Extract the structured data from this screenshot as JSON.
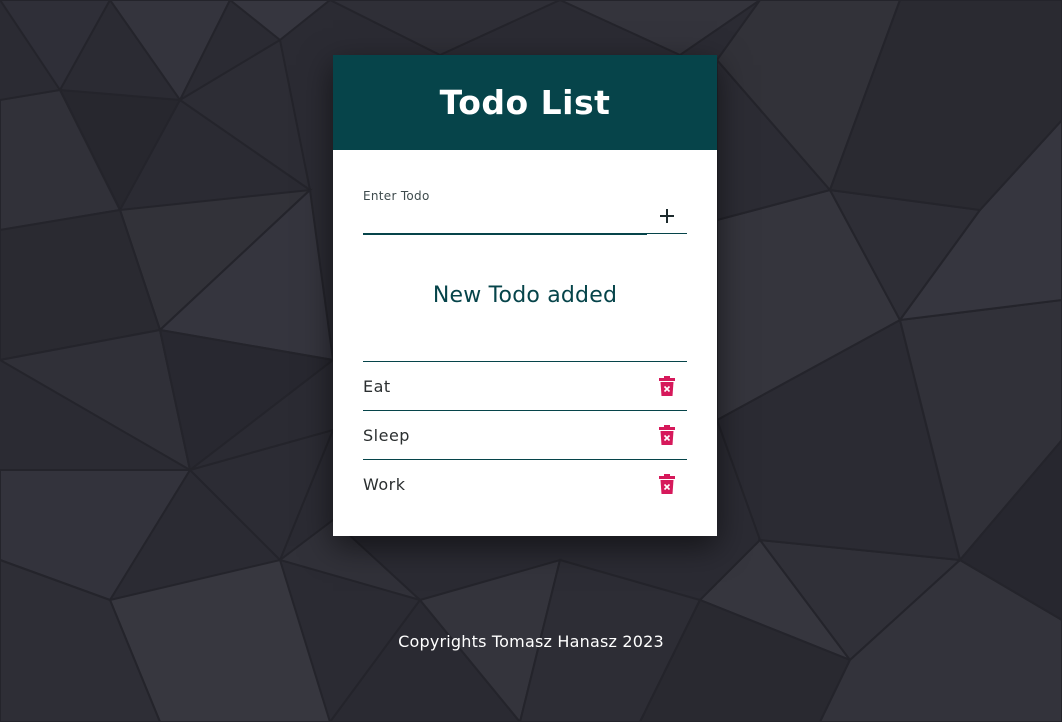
{
  "app": {
    "title": "Todo List"
  },
  "form": {
    "input_label": "Enter Todo",
    "input_value": "",
    "add_icon": "plus-icon"
  },
  "message": "New Todo added",
  "todos": [
    {
      "text": "Eat",
      "delete_icon": "trash-icon"
    },
    {
      "text": "Sleep",
      "delete_icon": "trash-icon"
    },
    {
      "text": "Work",
      "delete_icon": "trash-icon"
    }
  ],
  "footer": {
    "text": "Copyrights Tomasz Hanasz 2023"
  },
  "colors": {
    "header_bg": "#06444a",
    "page_bg": "#2b2b33",
    "delete_accent": "#d6195b",
    "card_bg": "#ffffff"
  }
}
